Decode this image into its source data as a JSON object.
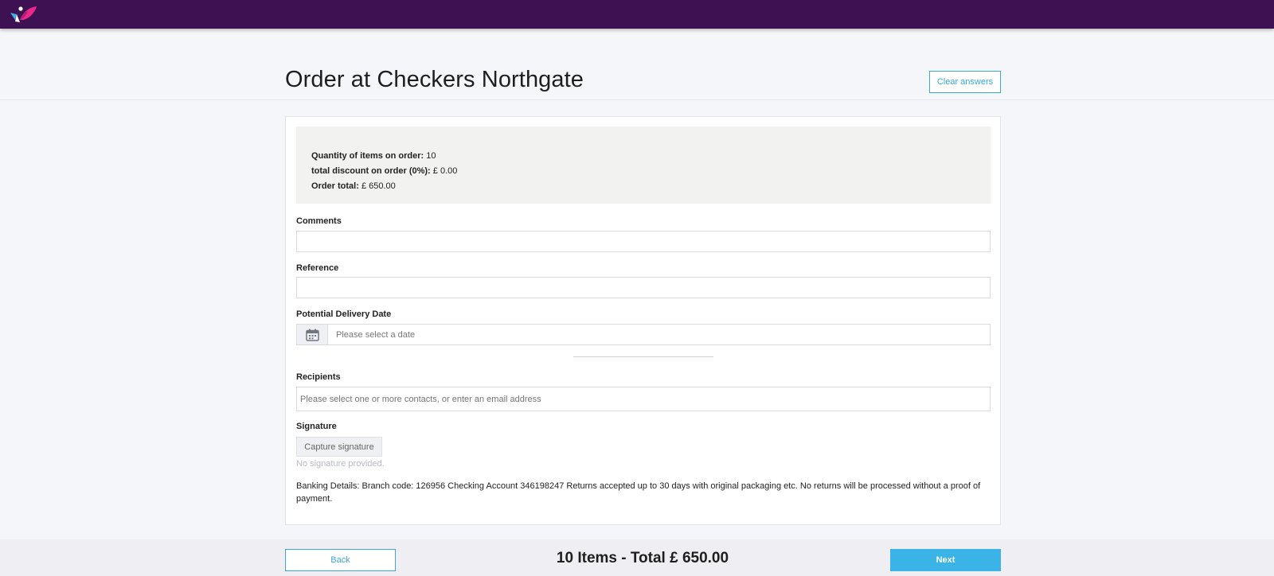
{
  "colors": {
    "topbar": "#3d1152",
    "accent": "#3aa8d8",
    "next_button": "#3ab3e6",
    "logo_pink": "#e8298a",
    "logo_blue": "#3ab3e6"
  },
  "header": {
    "logo_icon": "brand-logo-icon"
  },
  "page": {
    "title": "Order at Checkers Northgate",
    "clear_label": "Clear answers"
  },
  "summary": {
    "quantity_label": "Quantity of items on order:",
    "quantity_value": "10",
    "discount_label": "total discount on order (0%):",
    "discount_value": "£ 0.00",
    "total_label": "Order total:",
    "total_value": "£ 650.00"
  },
  "form": {
    "comments_label": "Comments",
    "comments_value": "",
    "reference_label": "Reference",
    "reference_value": "",
    "delivery_label": "Potential Delivery Date",
    "delivery_placeholder": "Please select a date",
    "delivery_icon": "calendar-icon",
    "recipients_label": "Recipients",
    "recipients_placeholder": "Please select one or more contacts, or enter an email address",
    "signature_label": "Signature",
    "capture_label": "Capture signature",
    "no_signature_text": "No signature provided.",
    "banking_text": "Banking Details: Branch code: 126956 Checking Account 346198247 Returns accepted up to 30 days with original packaging etc. No returns will be processed without a proof of payment."
  },
  "footer": {
    "back_label": "Back",
    "summary_text": "10 Items - Total £ 650.00",
    "next_label": "Next"
  }
}
